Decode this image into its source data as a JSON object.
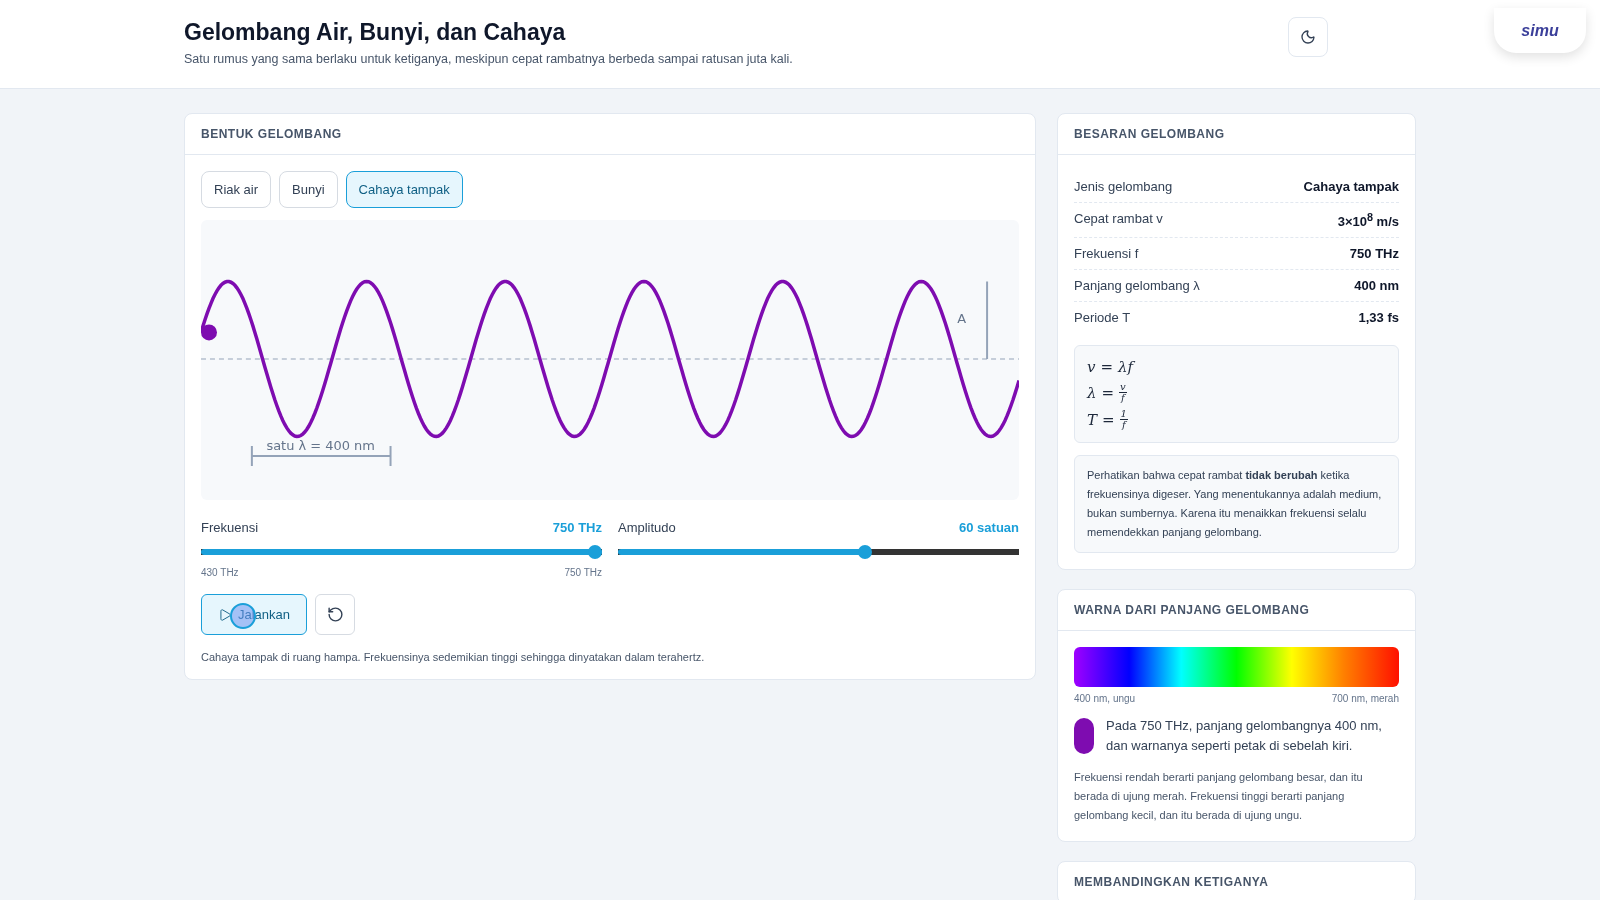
{
  "header": {
    "title": "Gelombang Air, Bunyi, dan Cahaya",
    "subtitle": "Satu rumus yang sama berlaku untuk ketiganya, meskipun cepat rambatnya berbeda sampai ratusan juta kali.",
    "logo": "simu"
  },
  "wave_card": {
    "title": "BENTUK GELOMBANG",
    "tabs": [
      {
        "label": "Riak air",
        "selected": false
      },
      {
        "label": "Bunyi",
        "selected": false
      },
      {
        "label": "Cahaya tampak",
        "selected": true
      }
    ],
    "wave": {
      "color": "#7e0cb0",
      "wavelength_label": "satu λ = 400 nm",
      "amplitude_label": "A"
    },
    "sliders": [
      {
        "label": "Frekuensi",
        "reading": "750 THz",
        "level": 1.0,
        "min_label": "430 THz",
        "max_label": "750 THz"
      },
      {
        "label": "Amplitudo",
        "reading": "60 satuan",
        "level": 0.62
      }
    ],
    "run_button": "Jalankan",
    "note": "Cahaya tampak di ruang hampa. Frekuensinya sedemikian tinggi sehingga dinyatakan dalam terahertz."
  },
  "quantities_card": {
    "title": "BESARAN GELOMBANG",
    "rows": [
      {
        "label": "Jenis gelombang",
        "value": "Cahaya tampak"
      },
      {
        "label": "Cepat rambat v",
        "value": "3×10$^{8}$ m/s"
      },
      {
        "label": "Frekuensi f",
        "value": "750 THz"
      },
      {
        "label": "Panjang gelombang λ",
        "value": "400 nm"
      },
      {
        "label": "Periode T",
        "value": "1,33 fs"
      }
    ],
    "formulas": [
      {
        "kind": "plain",
        "lhs": "v",
        "op": "=",
        "rhs": "λf"
      },
      {
        "kind": "fraction",
        "lhs": "λ",
        "op": "=",
        "num": "v",
        "den": "f"
      },
      {
        "kind": "fraction",
        "lhs": "T",
        "op": "=",
        "num": "1",
        "den": "f"
      }
    ],
    "note": "Perhatikan bahwa cepat rambat **tidak berubah** ketika frekuensinya digeser. Yang menentukannya adalah medium, bukan sumbernya. Karena itu menaikkan frekuensi selalu memendekkan panjang gelombang."
  },
  "color_card": {
    "title": "WARNA DARI PANJANG GELOMBANG",
    "min_label": "400 nm, ungu",
    "max_label": "700 nm, merah",
    "swatch": {
      "color": "#7e0cb0"
    },
    "result": "Pada 750 THz, panjang gelombangnya 400 nm, dan warnanya seperti petak di sebelah kiri.",
    "explanation": "Frekuensi rendah berarti panjang gelombang besar, dan itu berada di ujung merah. Frekuensi tinggi berarti panjang gelombang kecil, dan itu berada di ujung ungu."
  },
  "compare_card": {
    "title": "MEMBANDINGKAN KETIGANYA"
  }
}
